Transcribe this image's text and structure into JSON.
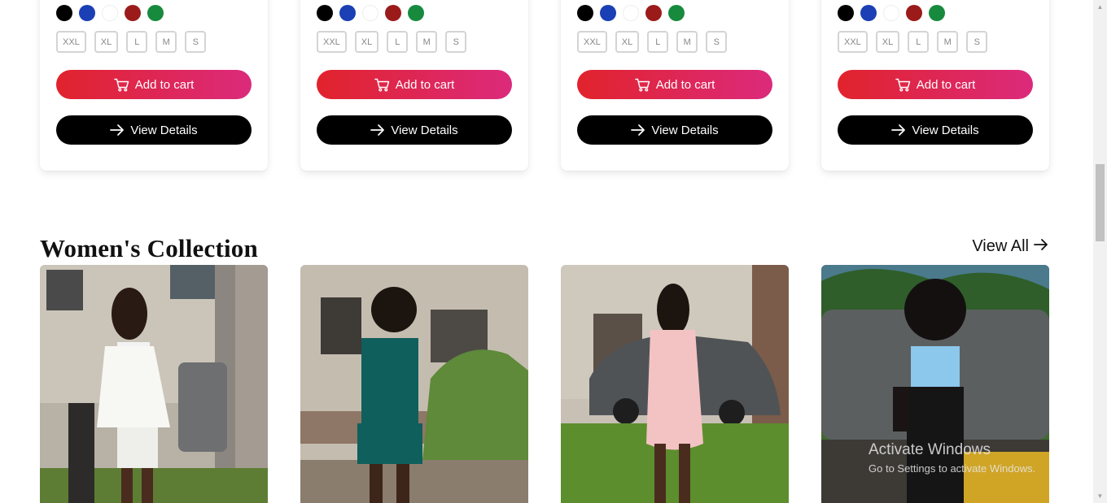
{
  "colors": {
    "swatches": [
      "#000000",
      "#1b3fb4",
      "#ffffff",
      "#9b1b1b",
      "#178a3e"
    ],
    "cart_gradient_start": "#e1232c",
    "cart_gradient_end": "#dc2a7c",
    "details_bg": "#000000"
  },
  "product_cards": [
    {
      "sizes": [
        "XXL",
        "XL",
        "L",
        "M",
        "S"
      ],
      "cart_label": "Add to cart",
      "details_label": "View Details"
    },
    {
      "sizes": [
        "XXL",
        "XL",
        "L",
        "M",
        "S"
      ],
      "cart_label": "Add to cart",
      "details_label": "View Details"
    },
    {
      "sizes": [
        "XXL",
        "XL",
        "L",
        "M",
        "S"
      ],
      "cart_label": "Add to cart",
      "details_label": "View Details"
    },
    {
      "sizes": [
        "XXL",
        "XL",
        "L",
        "M",
        "S"
      ],
      "cart_label": "Add to cart",
      "details_label": "View Details"
    }
  ],
  "icons": {
    "cart": "cart-icon",
    "arrow": "arrow-right-icon"
  },
  "womens_section": {
    "title": "Women's Collection",
    "view_all": "View All"
  },
  "products": [
    {
      "image": "woman-white-outfit-photo"
    },
    {
      "image": "woman-teal-shirt-shorts-photo"
    },
    {
      "image": "woman-pink-dress-photo"
    },
    {
      "image": "woman-blue-top-photo"
    }
  ],
  "watermark": {
    "title": "Activate Windows",
    "subtitle": "Go to Settings to activate Windows."
  }
}
